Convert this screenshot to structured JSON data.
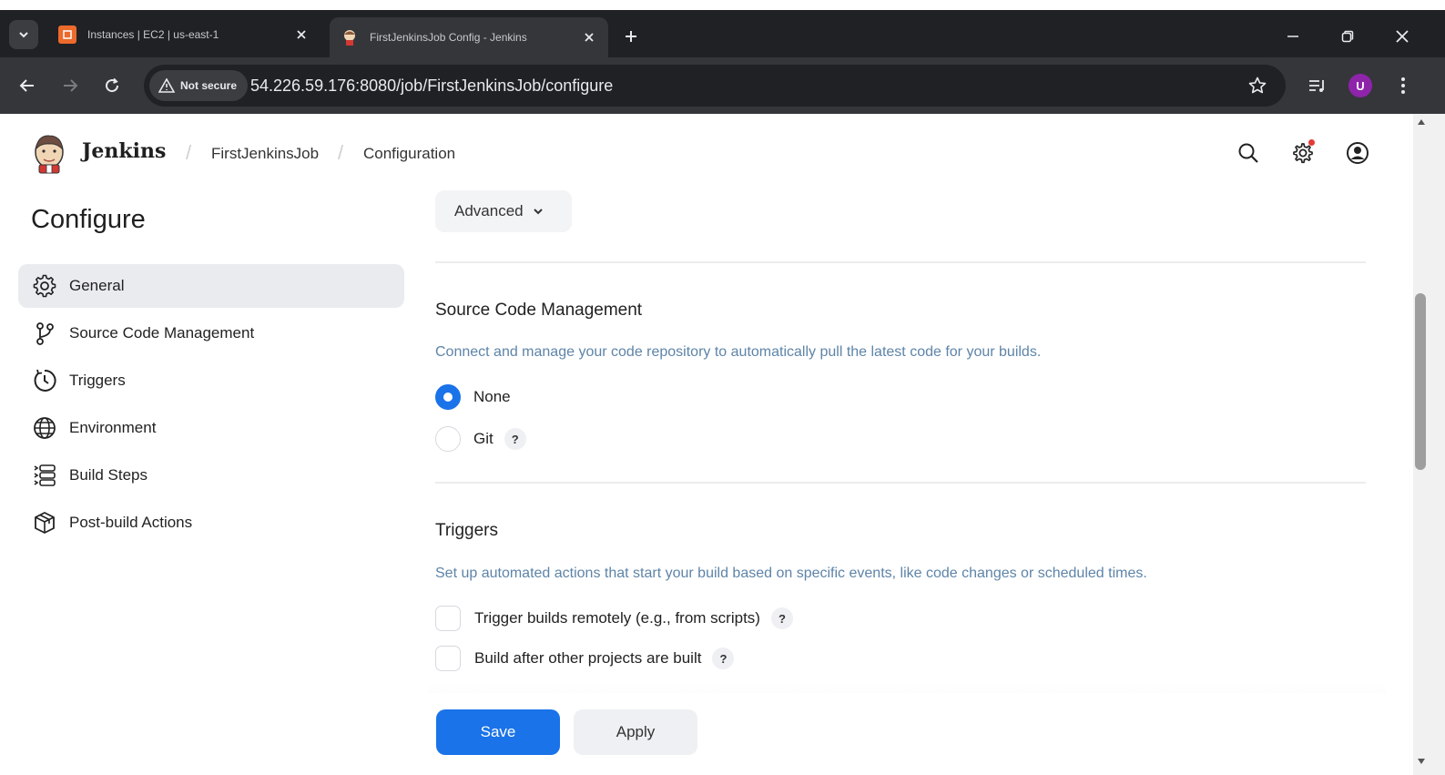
{
  "browser": {
    "tabs": [
      {
        "title": "Instances | EC2 | us-east-1",
        "favicon": "aws-ec2-icon"
      },
      {
        "title": "FirstJenkinsJob Config - Jenkins",
        "favicon": "jenkins-icon"
      }
    ],
    "security_label": "Not secure",
    "url_host": "54.226.59.176",
    "url_path": ":8080/job/FirstJenkinsJob/configure",
    "profile_initial": "U",
    "profile_color": "#8e24aa"
  },
  "header": {
    "brand": "Jenkins",
    "breadcrumbs": [
      "FirstJenkinsJob",
      "Configuration"
    ]
  },
  "sidebar": {
    "title": "Configure",
    "items": [
      {
        "label": "General",
        "icon": "gear-icon",
        "active": true
      },
      {
        "label": "Source Code Management",
        "icon": "branch-icon",
        "active": false
      },
      {
        "label": "Triggers",
        "icon": "clock-icon",
        "active": false
      },
      {
        "label": "Environment",
        "icon": "globe-icon",
        "active": false
      },
      {
        "label": "Build Steps",
        "icon": "list-icon",
        "active": false
      },
      {
        "label": "Post-build Actions",
        "icon": "package-icon",
        "active": false
      }
    ]
  },
  "main": {
    "advanced_label": "Advanced",
    "scm": {
      "title": "Source Code Management",
      "description": "Connect and manage your code repository to automatically pull the latest code for your builds.",
      "options": [
        {
          "label": "None",
          "selected": true,
          "help": false
        },
        {
          "label": "Git",
          "selected": false,
          "help": true
        }
      ]
    },
    "triggers": {
      "title": "Triggers",
      "description": "Set up automated actions that start your build based on specific events, like code changes or scheduled times.",
      "options": [
        {
          "label": "Trigger builds remotely (e.g., from scripts)",
          "checked": false
        },
        {
          "label": "Build after other projects are built",
          "checked": false
        }
      ],
      "help_symbol": "?"
    }
  },
  "actions": {
    "save_label": "Save",
    "apply_label": "Apply"
  },
  "colors": {
    "accent": "#1a73e8",
    "description_text": "#5e84a8"
  }
}
